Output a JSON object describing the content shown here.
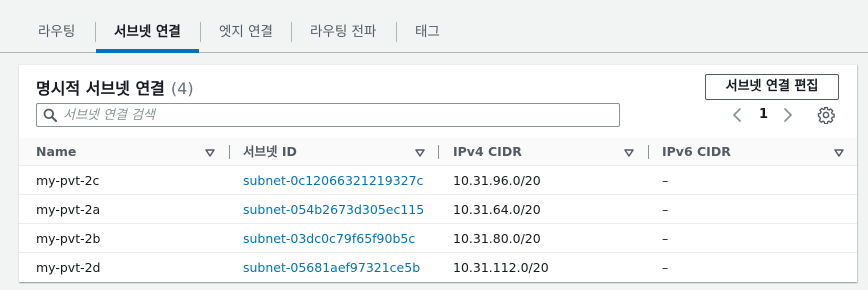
{
  "tabs": [
    {
      "label": "라우팅"
    },
    {
      "label": "서브넷 연결"
    },
    {
      "label": "엣지 연결"
    },
    {
      "label": "라우팅 전파"
    },
    {
      "label": "태그"
    }
  ],
  "panel": {
    "title": "명시적 서브넷 연결",
    "count": "(4)",
    "edit_button": "서브넷 연결 편집",
    "search_placeholder": "서브넷 연결 검색",
    "page": "1"
  },
  "table": {
    "columns": [
      "Name",
      "서브넷 ID",
      "IPv4 CIDR",
      "IPv6 CIDR"
    ],
    "rows": [
      {
        "name": "my-pvt-2c",
        "subnet_id": "subnet-0c12066321219327c",
        "ipv4": "10.31.96.0/20",
        "ipv6": "–"
      },
      {
        "name": "my-pvt-2a",
        "subnet_id": "subnet-054b2673d305ec115",
        "ipv4": "10.31.64.0/20",
        "ipv6": "–"
      },
      {
        "name": "my-pvt-2b",
        "subnet_id": "subnet-03dc0c79f65f90b5c",
        "ipv4": "10.31.80.0/20",
        "ipv6": "–"
      },
      {
        "name": "my-pvt-2d",
        "subnet_id": "subnet-05681aef97321ce5b",
        "ipv4": "10.31.112.0/20",
        "ipv6": "–"
      }
    ]
  },
  "icons": {
    "search": "search-icon",
    "prev": "chevron-left-icon",
    "next": "chevron-right-icon",
    "settings": "gear-icon",
    "sort": "caret-down-icon"
  },
  "colors": {
    "accent": "#0073bb",
    "link": "#0073bb",
    "text": "#16191f",
    "background": "#f2f3f3"
  }
}
